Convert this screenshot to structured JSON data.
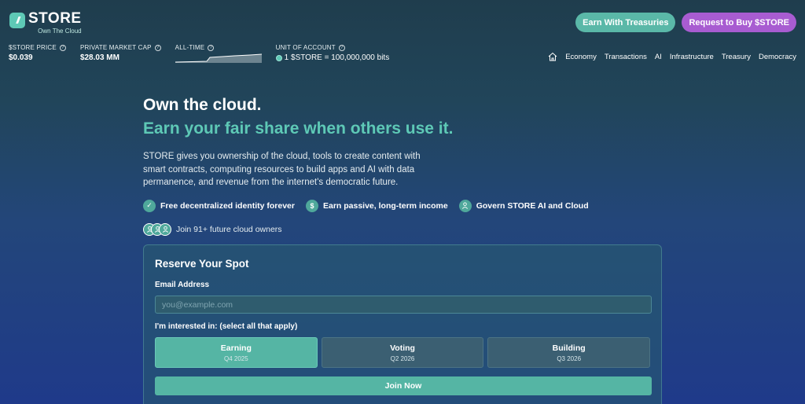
{
  "brand": {
    "mark": "//",
    "name": "STORE",
    "tagline": "Own The Cloud"
  },
  "top_actions": {
    "earn_label": "Earn With Treasuries",
    "buy_label": "Request to Buy $STORE"
  },
  "stats": {
    "price": {
      "label": "$STORE PRICE",
      "value": "$0.039"
    },
    "market_cap": {
      "label": "PRIVATE MARKET CAP",
      "value": "$28.03 MM"
    },
    "all_time": {
      "label": "ALL-TIME"
    },
    "unit": {
      "label": "UNIT OF ACCOUNT",
      "value": "1 $STORE = 100,000,000 bits"
    }
  },
  "nav": {
    "items": [
      "Economy",
      "Transactions",
      "AI",
      "Infrastructure",
      "Treasury",
      "Democracy"
    ]
  },
  "hero": {
    "title": "Own the cloud.",
    "subtitle": "Earn your fair share when others use it.",
    "description": "STORE gives you ownership of the cloud, tools to create content with smart contracts, computing resources to build apps and AI with data permanence, and revenue from the internet's democratic future.",
    "features": [
      {
        "icon": "check-icon",
        "label": "Free decentralized identity forever"
      },
      {
        "icon": "dollar-icon",
        "label": "Earn passive, long-term income"
      },
      {
        "icon": "people-icon",
        "label": "Govern STORE AI and Cloud"
      }
    ],
    "join_text": "Join 91+ future cloud owners"
  },
  "form": {
    "title": "Reserve Your Spot",
    "email_label": "Email Address",
    "email_placeholder": "you@example.com",
    "email_value": "",
    "interest_label": "I'm interested in: (select all that apply)",
    "options": [
      {
        "name": "Earning",
        "date": "Q4 2025",
        "selected": true
      },
      {
        "name": "Voting",
        "date": "Q2 2026",
        "selected": false
      },
      {
        "name": "Building",
        "date": "Q3 2026",
        "selected": false
      }
    ],
    "submit_label": "Join Now"
  },
  "colors": {
    "accent": "#5ec9b6",
    "purple": "#a85cd1"
  }
}
